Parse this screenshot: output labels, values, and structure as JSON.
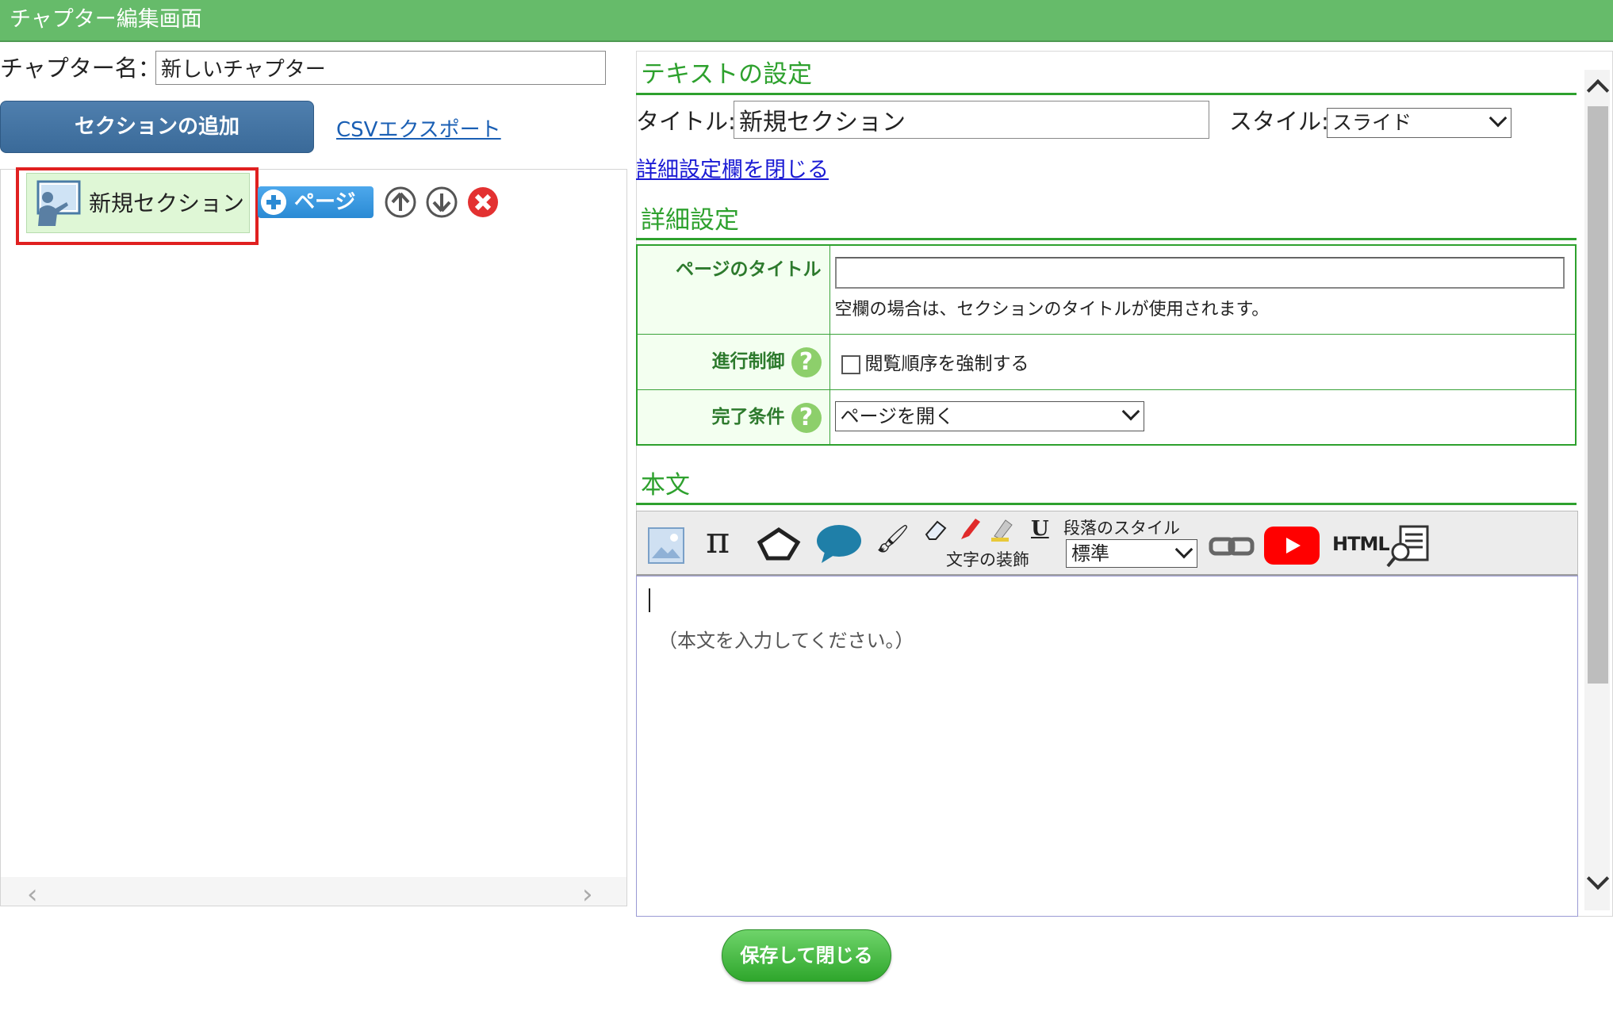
{
  "window": {
    "title": "チャプター編集画面"
  },
  "chapter": {
    "name_label": "チャプター名：",
    "name_value": "新しいチャプター",
    "add_section_label": "セクションの追加",
    "csv_export_label": "CSVエクスポート"
  },
  "tree": {
    "section_label": "新規セクション",
    "page_button_label": "ページ",
    "icons": [
      "teacher-icon",
      "plus-icon",
      "arrow-up-icon",
      "arrow-down-icon",
      "delete-icon"
    ]
  },
  "text_settings": {
    "heading": "テキストの設定",
    "title_label": "タイトル:",
    "title_value": "新規セクション",
    "style_label": "スタイル:",
    "style_value": "スライド",
    "close_detail_link": "詳細設定欄を閉じる"
  },
  "detail": {
    "heading": "詳細設定",
    "page_title_label": "ページのタイトル",
    "page_title_value": "",
    "page_title_hint": "空欄の場合は、セクションのタイトルが使用されます。",
    "progress_label": "進行制御",
    "progress_checkbox_label": "閲覧順序を強制する",
    "progress_checked": false,
    "completion_label": "完了条件",
    "completion_value": "ページを開く"
  },
  "body": {
    "heading": "本文",
    "toolbar_icons": [
      "image-icon",
      "pi-icon",
      "shape-icon",
      "speech-bubble-icon",
      "brush-icon",
      "eraser-icon",
      "marker-icon",
      "highlighter-icon",
      "underline-icon",
      "link-icon",
      "youtube-icon",
      "html-icon",
      "preview-icon"
    ],
    "decoration_label": "文字の装飾",
    "paragraph_style_label": "段落のスタイル",
    "paragraph_style_value": "標準",
    "html_label": "HTML",
    "underline_glyph": "U",
    "pi_glyph": "π",
    "placeholder": "（本文を入力してください。）"
  },
  "footer": {
    "save_close_label": "保存して閉じる"
  },
  "colors": {
    "titlebar": "#66bb6a",
    "accent_green": "#2ea12e",
    "primary_blue": "#3a6a99",
    "highlight_red": "#e02020"
  }
}
